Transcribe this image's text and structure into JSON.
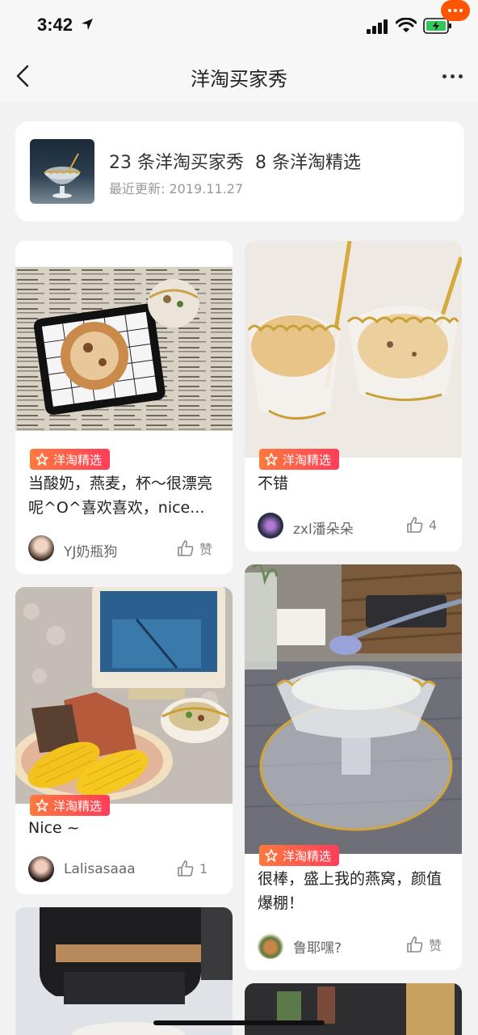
{
  "status_bar": {
    "time": "3:42"
  },
  "nav": {
    "title": "洋淘买家秀"
  },
  "summary": {
    "count_shows": "23 条洋淘买家秀",
    "count_featured": "8 条洋淘精选",
    "updated": "最近更新: 2019.11.27"
  },
  "badge_label": "洋淘精选",
  "colors": {
    "accent": "#ff5500",
    "badge_start": "#ff7a3d",
    "badge_end": "#ff3d5a",
    "background": "#f2f2f2"
  },
  "cards": [
    {
      "text": "当酸奶，燕麦，杯～很漂亮呢^O^喜欢喜欢，nice...",
      "user": "YJ奶瓶狗",
      "likes": "赞",
      "featured": true
    },
    {
      "text": "不错",
      "user": "zxl潘朵朵",
      "likes": "4",
      "featured": true
    },
    {
      "text": "Nice ~",
      "user": "Lalisasaaa",
      "likes": "1",
      "featured": true
    },
    {
      "text": "很棒，盛上我的燕窝，颜值爆棚！",
      "user": "鲁耶嘿?",
      "likes": "赞",
      "featured": true
    }
  ],
  "icons": {
    "back": "chevron-left-icon",
    "more": "more-dots-icon",
    "message": "message-bubble-icon",
    "badge": "featured-star-icon",
    "like": "thumbs-up-icon"
  }
}
